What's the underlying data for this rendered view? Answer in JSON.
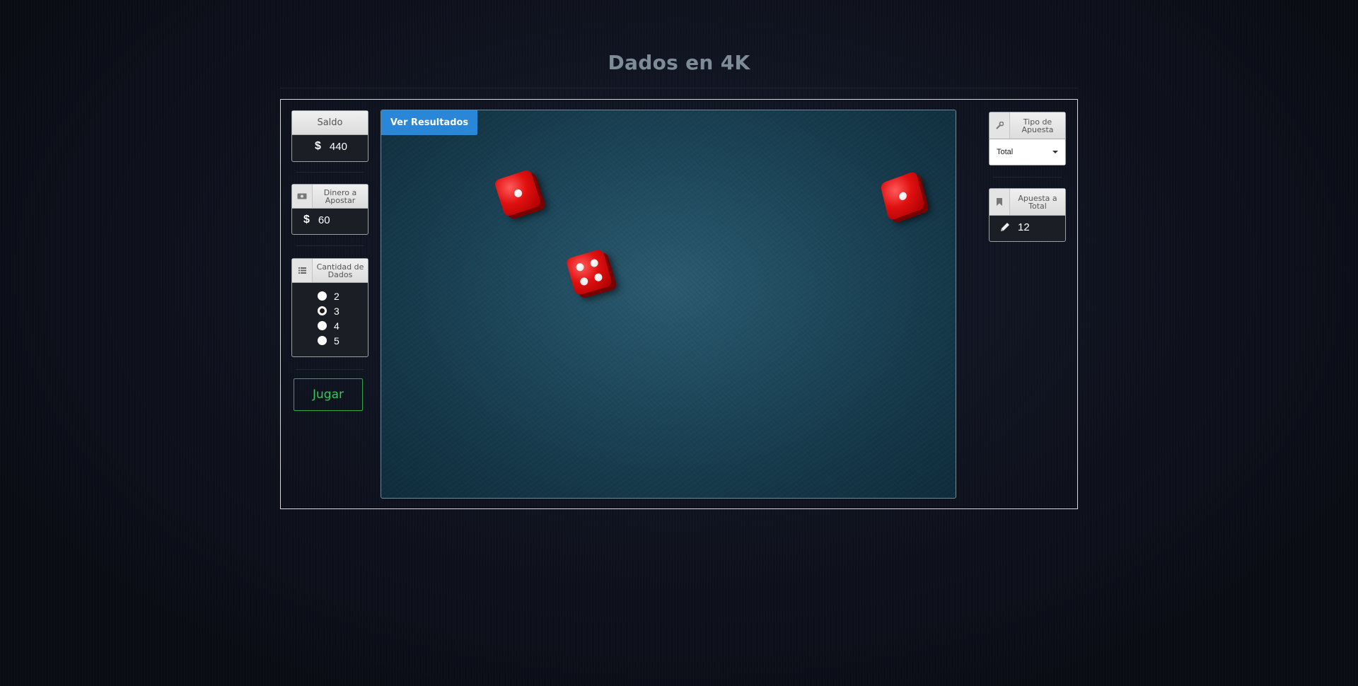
{
  "page": {
    "title": "Dados en 4K"
  },
  "left_panel": {
    "balance": {
      "label": "Saldo",
      "currency": "$",
      "value": "440"
    },
    "bet_amount": {
      "label": "Dinero a Apostar",
      "currency": "$",
      "value": "60",
      "icon": "money-icon"
    },
    "dice_count": {
      "label": "Cantidad de Dados",
      "icon": "list-icon",
      "options": [
        "2",
        "3",
        "4",
        "5"
      ],
      "selected": "3"
    },
    "play_button": "Jugar"
  },
  "table": {
    "results_button": "Ver Resultados",
    "dice": [
      {
        "value": 1
      },
      {
        "value": 4
      },
      {
        "value": 1
      }
    ],
    "die_color": "#e01010"
  },
  "right_panel": {
    "bet_type": {
      "label": "Tipo de Apuesta",
      "icon": "wrench-icon",
      "selected": "Total"
    },
    "bet_total": {
      "label": "Apuesta a Total",
      "icon": "bookmark-icon",
      "value": "12",
      "value_icon": "pencil-icon"
    }
  },
  "colors": {
    "accent": "#2a86d6",
    "play": "#2ecc57",
    "background": "#0c0f1a"
  }
}
